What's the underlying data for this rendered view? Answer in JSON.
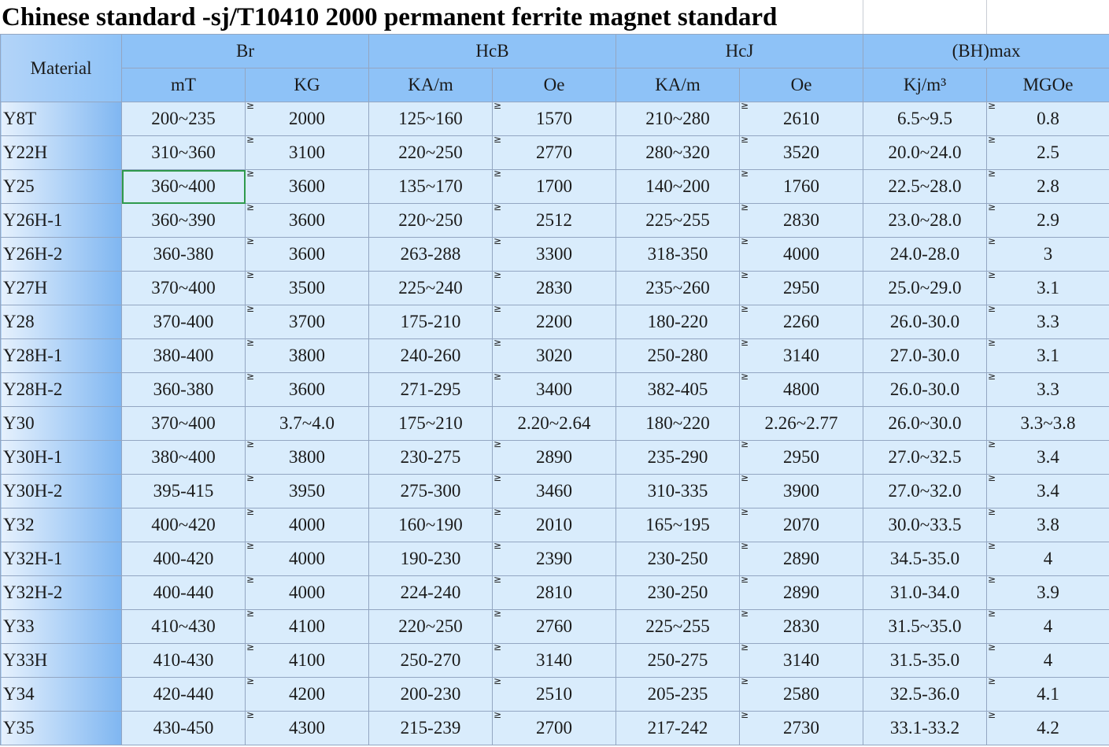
{
  "title": "Chinese standard -sj/T10410 2000 permanent ferrite magnet standard",
  "header": {
    "material": "Material",
    "groups": [
      "Br",
      "HcB",
      "HcJ",
      "(BH)max"
    ],
    "units": [
      "mT",
      "KG",
      "KA/m",
      "Oe",
      "KA/m",
      "Oe",
      "Kj/m³",
      "MGOe"
    ]
  },
  "ge_symbol": "≥",
  "rows": [
    {
      "material": "Y8T",
      "values": [
        "200~235",
        "2000",
        "125~160",
        "1570",
        "210~280",
        "2610",
        "6.5~9.5",
        "0.8"
      ],
      "marks": true
    },
    {
      "material": "Y22H",
      "values": [
        "310~360",
        "3100",
        "220~250",
        "2770",
        "280~320",
        "3520",
        "20.0~24.0",
        "2.5"
      ],
      "marks": true
    },
    {
      "material": "Y25",
      "values": [
        "360~400",
        "3600",
        "135~170",
        "1700",
        "140~200",
        "1760",
        "22.5~28.0",
        "2.8"
      ],
      "marks": true
    },
    {
      "material": "Y26H-1",
      "values": [
        "360~390",
        "3600",
        "220~250",
        "2512",
        "225~255",
        "2830",
        "23.0~28.0",
        "2.9"
      ],
      "marks": true
    },
    {
      "material": "Y26H-2",
      "values": [
        "360-380",
        "3600",
        "263-288",
        "3300",
        "318-350",
        "4000",
        "24.0-28.0",
        "3"
      ],
      "marks": true
    },
    {
      "material": "Y27H",
      "values": [
        "370~400",
        "3500",
        "225~240",
        "2830",
        "235~260",
        "2950",
        "25.0~29.0",
        "3.1"
      ],
      "marks": true
    },
    {
      "material": "Y28",
      "values": [
        "370-400",
        "3700",
        "175-210",
        "2200",
        "180-220",
        "2260",
        "26.0-30.0",
        "3.3"
      ],
      "marks": true
    },
    {
      "material": "Y28H-1",
      "values": [
        "380-400",
        "3800",
        "240-260",
        "3020",
        "250-280",
        "3140",
        "27.0-30.0",
        "3.1"
      ],
      "marks": true
    },
    {
      "material": "Y28H-2",
      "values": [
        "360-380",
        "3600",
        "271-295",
        "3400",
        "382-405",
        "4800",
        "26.0-30.0",
        "3.3"
      ],
      "marks": true
    },
    {
      "material": "Y30",
      "values": [
        "370~400",
        "3.7~4.0",
        "175~210",
        "2.20~2.64",
        "180~220",
        "2.26~2.77",
        "26.0~30.0",
        "3.3~3.8"
      ],
      "marks": false
    },
    {
      "material": "Y30H-1",
      "values": [
        "380~400",
        "3800",
        "230-275",
        "2890",
        "235-290",
        "2950",
        "27.0~32.5",
        "3.4"
      ],
      "marks": true
    },
    {
      "material": "Y30H-2",
      "values": [
        "395-415",
        "3950",
        "275-300",
        "3460",
        "310-335",
        "3900",
        "27.0~32.0",
        "3.4"
      ],
      "marks": true
    },
    {
      "material": "Y32",
      "values": [
        "400~420",
        "4000",
        "160~190",
        "2010",
        "165~195",
        "2070",
        "30.0~33.5",
        "3.8"
      ],
      "marks": true
    },
    {
      "material": "Y32H-1",
      "values": [
        "400-420",
        "4000",
        "190-230",
        "2390",
        "230-250",
        "2890",
        "34.5-35.0",
        "4"
      ],
      "marks": true
    },
    {
      "material": "Y32H-2",
      "values": [
        "400-440",
        "4000",
        "224-240",
        "2810",
        "230-250",
        "2890",
        "31.0-34.0",
        "3.9"
      ],
      "marks": true
    },
    {
      "material": "Y33",
      "values": [
        "410~430",
        "4100",
        "220~250",
        "2760",
        "225~255",
        "2830",
        "31.5~35.0",
        "4"
      ],
      "marks": true
    },
    {
      "material": "Y33H",
      "values": [
        "410-430",
        "4100",
        "250-270",
        "3140",
        "250-275",
        "3140",
        "31.5-35.0",
        "4"
      ],
      "marks": true
    },
    {
      "material": "Y34",
      "values": [
        "420-440",
        "4200",
        "200-230",
        "2510",
        "205-235",
        "2580",
        "32.5-36.0",
        "4.1"
      ],
      "marks": true
    },
    {
      "material": "Y35",
      "values": [
        "430-450",
        "4300",
        "215-239",
        "2700",
        "217-242",
        "2730",
        "33.1-33.2",
        "4.2"
      ],
      "marks": true
    }
  ],
  "selected_cell": {
    "row": 2,
    "col": 0
  },
  "colors": {
    "header_bg": "#8ec2f7",
    "cell_bg": "#d9ecfc",
    "selection": "#2f9a4c"
  }
}
